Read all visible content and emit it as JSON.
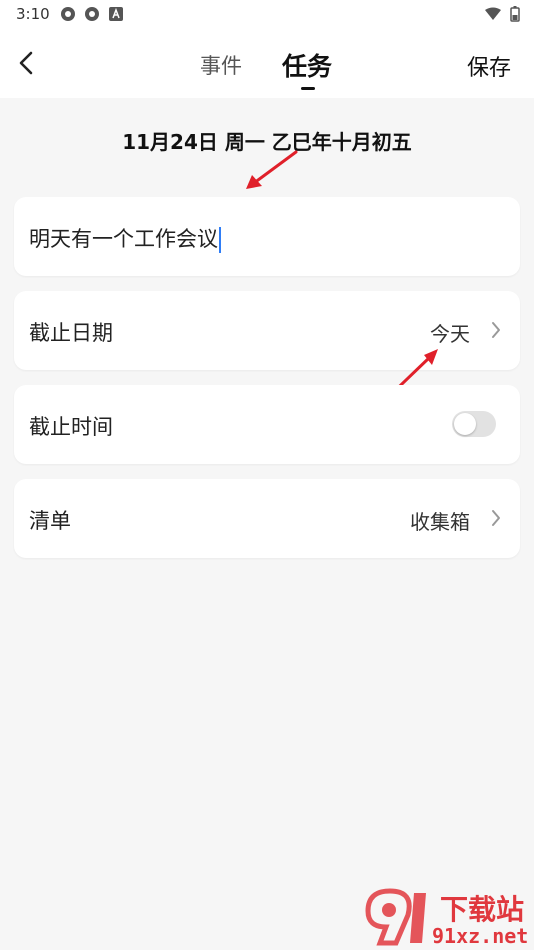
{
  "status": {
    "time": "3:10"
  },
  "header": {
    "tabs": [
      {
        "label": "事件",
        "active": false
      },
      {
        "label": "任务",
        "active": true
      }
    ],
    "save_label": "保存"
  },
  "date_line": "11月24日 周一 乙巳年十月初五",
  "task_title": "明天有一个工作会议",
  "rows": {
    "deadline_date": {
      "label": "截止日期",
      "value": "今天"
    },
    "deadline_time": {
      "label": "截止时间",
      "toggle_on": false
    },
    "list": {
      "label": "清单",
      "value": "收集箱"
    }
  },
  "watermark": {
    "line1": "下载站",
    "line2": "91xz.net"
  },
  "colors": {
    "accent_caret": "#2f7df6",
    "annotation_arrow": "#e0202a",
    "watermark": "#e0383e"
  }
}
